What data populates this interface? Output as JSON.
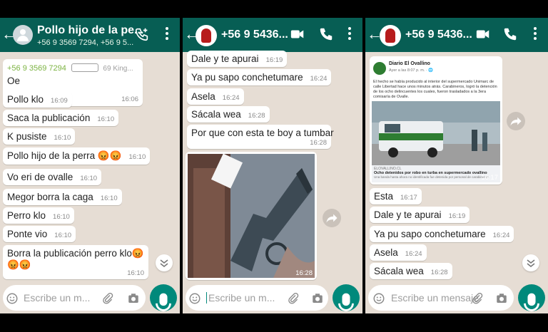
{
  "colors": {
    "header": "#075e54",
    "chat_bg": "#e6ddd4",
    "accent": "#00897b",
    "sender": "#7cb342"
  },
  "panel1": {
    "title": "Pollo hijo de la pe...",
    "subtitle": "+56 9 3569 7294, +56 9 5...",
    "first_sender": "+56 9 3569 7294",
    "first_sender_extra": "69  King...",
    "messages": [
      {
        "text": "Oe",
        "time": "16:06"
      },
      {
        "text": "Pollo klo",
        "time": "16:09"
      },
      {
        "text": "Saca la publicación",
        "time": "16:10"
      },
      {
        "text": "K pusiste",
        "time": "16:10"
      },
      {
        "text": "Pollo hijo de la perra 😡😡",
        "time": "16:10"
      },
      {
        "text": "Vo eri de ovalle",
        "time": "16:10"
      },
      {
        "text": "Megor borra la caga",
        "time": "16:10"
      },
      {
        "text": "Perro klo",
        "time": "16:10"
      },
      {
        "text": "Ponte vio",
        "time": "16:10"
      },
      {
        "text": "Borra la publicación perro klo😡",
        "text2": "😡😡",
        "time": "16:10"
      }
    ],
    "placeholder": "Escribe un m..."
  },
  "panel2": {
    "title": "+56 9 5436...",
    "messages": [
      {
        "text": "Dale y te apurai",
        "time": "16:19"
      },
      {
        "text": "Ya pu sapo conchetumare",
        "time": "16:24"
      },
      {
        "text": "Asela",
        "time": "16:24"
      },
      {
        "text": "Sácala wea",
        "time": "16:28"
      },
      {
        "text": "Por que con esta te boy a tumbar",
        "time": "16:28"
      }
    ],
    "image_time": "16:28",
    "placeholder": "Escribe un m..."
  },
  "panel3": {
    "title": "+56 9 5436...",
    "post": {
      "page": "Diario El Ovallino",
      "meta": "Ayer a las 8:07 p. m. · 🌐",
      "body": "El hecho se había producido al interior del supermercado Unimarc de calle Libertad hace unos minutos atrás. Carabineros, logró la detención de los ocho delincuentes los cuales, fueron trasladados a la 3era comisaría de Ovalle.",
      "link_domain": "ELOVALLINO.CL",
      "link_title": "Ocho detenidos por robo en turba en supermercado ovallino",
      "link_desc": "Una banda hasta ahora no identificada fue detenida por personal de carabineros",
      "time": "16:17"
    },
    "messages": [
      {
        "text": "Esta",
        "time": "16:17"
      },
      {
        "text": "Dale y te apurai",
        "time": "16:19"
      },
      {
        "text": "Ya pu sapo conchetumare",
        "time": "16:24"
      },
      {
        "text": "Asela",
        "time": "16:24"
      },
      {
        "text": "Sácala wea",
        "time": "16:28"
      }
    ],
    "placeholder": "Escribe un mensaje"
  },
  "icons": [
    "back-arrow-icon",
    "group-avatar-icon",
    "add-call-icon",
    "video-call-icon",
    "phone-icon",
    "menu-dots-icon",
    "emoji-icon",
    "attach-icon",
    "camera-icon",
    "mic-icon",
    "forward-icon",
    "scroll-down-icon"
  ]
}
